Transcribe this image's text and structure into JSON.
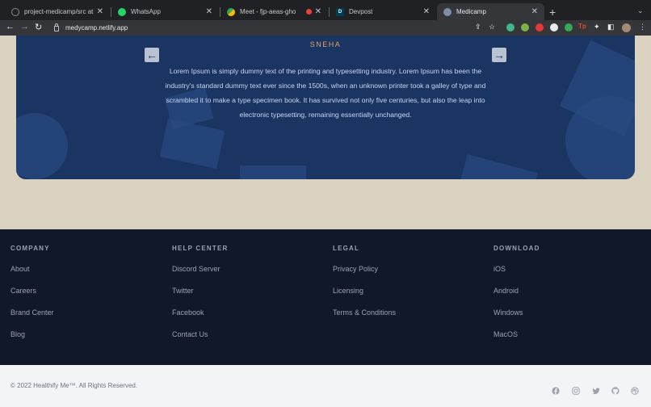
{
  "browser": {
    "tabs": [
      {
        "title": "project-medicamp/src at Sneh",
        "favicon": "github-icon"
      },
      {
        "title": "WhatsApp",
        "favicon": "whatsapp-icon"
      },
      {
        "title": "Meet - fjp-aeas-gho",
        "favicon": "meet-icon"
      },
      {
        "title": "",
        "favicon": "recording-icon"
      },
      {
        "title": "Devpost",
        "favicon": "devpost-icon"
      },
      {
        "title": "Medicamp",
        "favicon": "medicamp-icon",
        "active": true
      }
    ],
    "url": "medycamp.netlify.app"
  },
  "testimonial": {
    "name": "SNEHA",
    "text": "Lorem Ipsum is simply dummy text of the printing and typesetting industry. Lorem Ipsum has been the industry's standard dummy text ever since the 1500s, when an unknown printer took a galley of type and scrambled it to make a type specimen book. It has survived not only five centuries, but also the leap into electronic typesetting, remaining essentially unchanged.",
    "prev_icon": "←",
    "next_icon": "→"
  },
  "footer": {
    "columns": [
      {
        "heading": "COMPANY",
        "links": [
          "About",
          "Careers",
          "Brand Center",
          "Blog"
        ]
      },
      {
        "heading": "HELP CENTER",
        "links": [
          "Discord Server",
          "Twitter",
          "Facebook",
          "Contact Us"
        ]
      },
      {
        "heading": "LEGAL",
        "links": [
          "Privacy Policy",
          "Licensing",
          "Terms & Conditions"
        ]
      },
      {
        "heading": "DOWNLOAD",
        "links": [
          "iOS",
          "Android",
          "Windows",
          "MacOS"
        ]
      }
    ],
    "copyright": "© 2022 Healthify Me™. All Rights Reserved.",
    "social_icons": [
      "facebook-icon",
      "instagram-icon",
      "twitter-icon",
      "github-icon",
      "dribbble-icon"
    ]
  },
  "colors": {
    "card_bg": "#1b3563",
    "accent_name": "#e0a46a",
    "footer_bg": "#111827",
    "page_bg": "#d9d2c1"
  }
}
